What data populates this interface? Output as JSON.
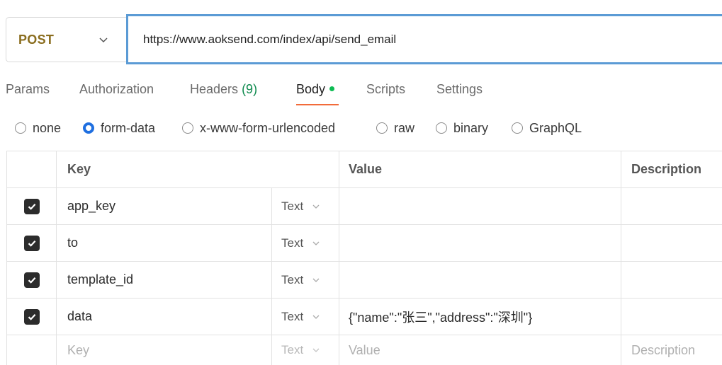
{
  "request": {
    "method": "POST",
    "url": "https://www.aoksend.com/index/api/send_email"
  },
  "tabs": [
    {
      "label": "Params"
    },
    {
      "label": "Authorization"
    },
    {
      "label": "Headers",
      "count": "(9)"
    },
    {
      "label": "Body"
    },
    {
      "label": "Scripts"
    },
    {
      "label": "Settings"
    }
  ],
  "body_types": [
    {
      "label": "none"
    },
    {
      "label": "form-data",
      "selected": true
    },
    {
      "label": "x-www-form-urlencoded"
    },
    {
      "label": "raw"
    },
    {
      "label": "binary"
    },
    {
      "label": "GraphQL"
    }
  ],
  "table": {
    "headers": {
      "key": "Key",
      "value": "Value",
      "description": "Description"
    },
    "rows": [
      {
        "key": "app_key",
        "type": "Text",
        "value": "",
        "checked": true
      },
      {
        "key": "to",
        "type": "Text",
        "value": "",
        "checked": true
      },
      {
        "key": "template_id",
        "type": "Text",
        "value": "",
        "checked": true
      },
      {
        "key": "data",
        "type": "Text",
        "value": "{\"name\":\"张三\",\"address\":\"深圳\"}",
        "checked": true
      }
    ],
    "new_row": {
      "key_placeholder": "Key",
      "type": "Text",
      "value_placeholder": "Value",
      "description_placeholder": "Description"
    }
  },
  "colors": {
    "accent": "#f26b3a",
    "selected_radio": "#1f6fe0",
    "method": "#8a6d1e",
    "body_dot": "#0cbb52"
  }
}
